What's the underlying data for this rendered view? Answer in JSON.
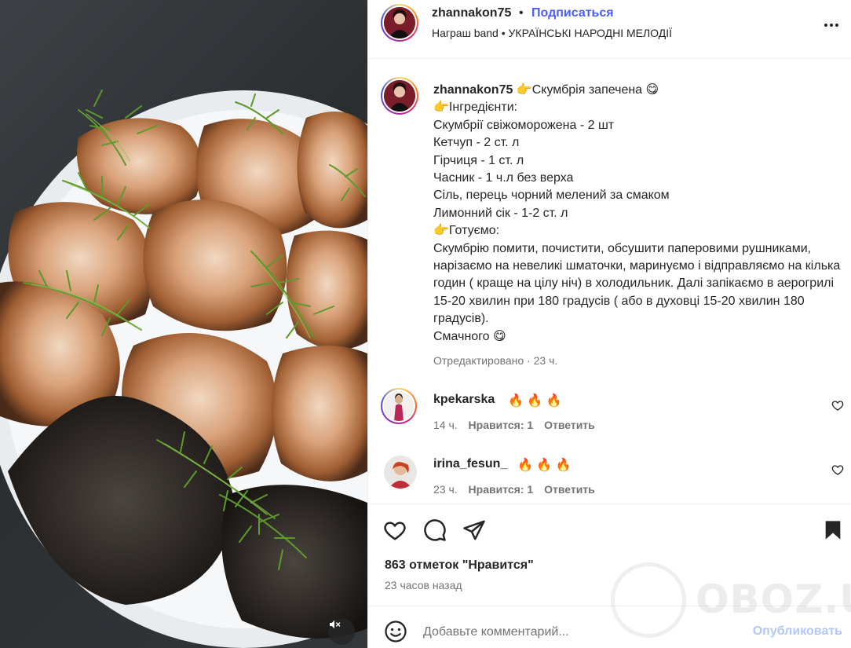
{
  "header": {
    "username": "zhannakon75",
    "dot": "•",
    "follow_label": "Подписаться",
    "subtitle": "Награш band • УКРАЇНСЬКІ НАРОДНІ МЕЛОДІЇ",
    "more_icon": "more-horizontal-icon"
  },
  "caption": {
    "author": "zhannakon75",
    "lines": [
      "👉Скумбрія запечена 😋",
      "👉Інгредієнти:",
      "Скумбрії свіжоморожена - 2 шт",
      "Кетчуп - 2 ст. л",
      "Гірчиця - 1 ст. л",
      "Часник - 1 ч.л без верха",
      "Сіль, перець чорний мелений за смаком",
      "Лимонний сік - 1-2 ст. л",
      "👉Готуємо:",
      "Скумбрію помити, почистити, обсушити паперовими рушниками, нарізаємо на невеликі шматочки, маринуємо і відправляємо на кілька годин ( краще на цілу ніч) в холодильник. Далі запікаємо в аерогрилі 15-20 хвилин при 180 градусів ( або в духовці 15-20 хвилин 180 градусів).",
      "Смачного 😋"
    ],
    "meta": "Отредактировано · 23 ч."
  },
  "comments": [
    {
      "user": "kpekarska",
      "text": "🔥 🔥 🔥",
      "time": "14 ч.",
      "likes": "Нравится: 1",
      "reply": "Ответить"
    },
    {
      "user": "irina_fesun_",
      "text": "🔥 🔥 🔥",
      "time": "23 ч.",
      "likes": "Нравится: 1",
      "reply": "Ответить"
    }
  ],
  "actions": {
    "icons": [
      "heart-icon",
      "comment-icon",
      "share-icon",
      "bookmark-icon"
    ]
  },
  "likes_text": "863 отметок \"Нравится\"",
  "time_text": "23 часов назад",
  "add_comment": {
    "placeholder": "Добавьте комментарий...",
    "post_label": "Опубликовать"
  },
  "watermark": {
    "text": "OBOZ.UA"
  },
  "colors": {
    "link_blue": "#4a5df9",
    "post_disabled": "#b3c6f8",
    "muted_text": "#737373",
    "primary_text": "#262626"
  }
}
